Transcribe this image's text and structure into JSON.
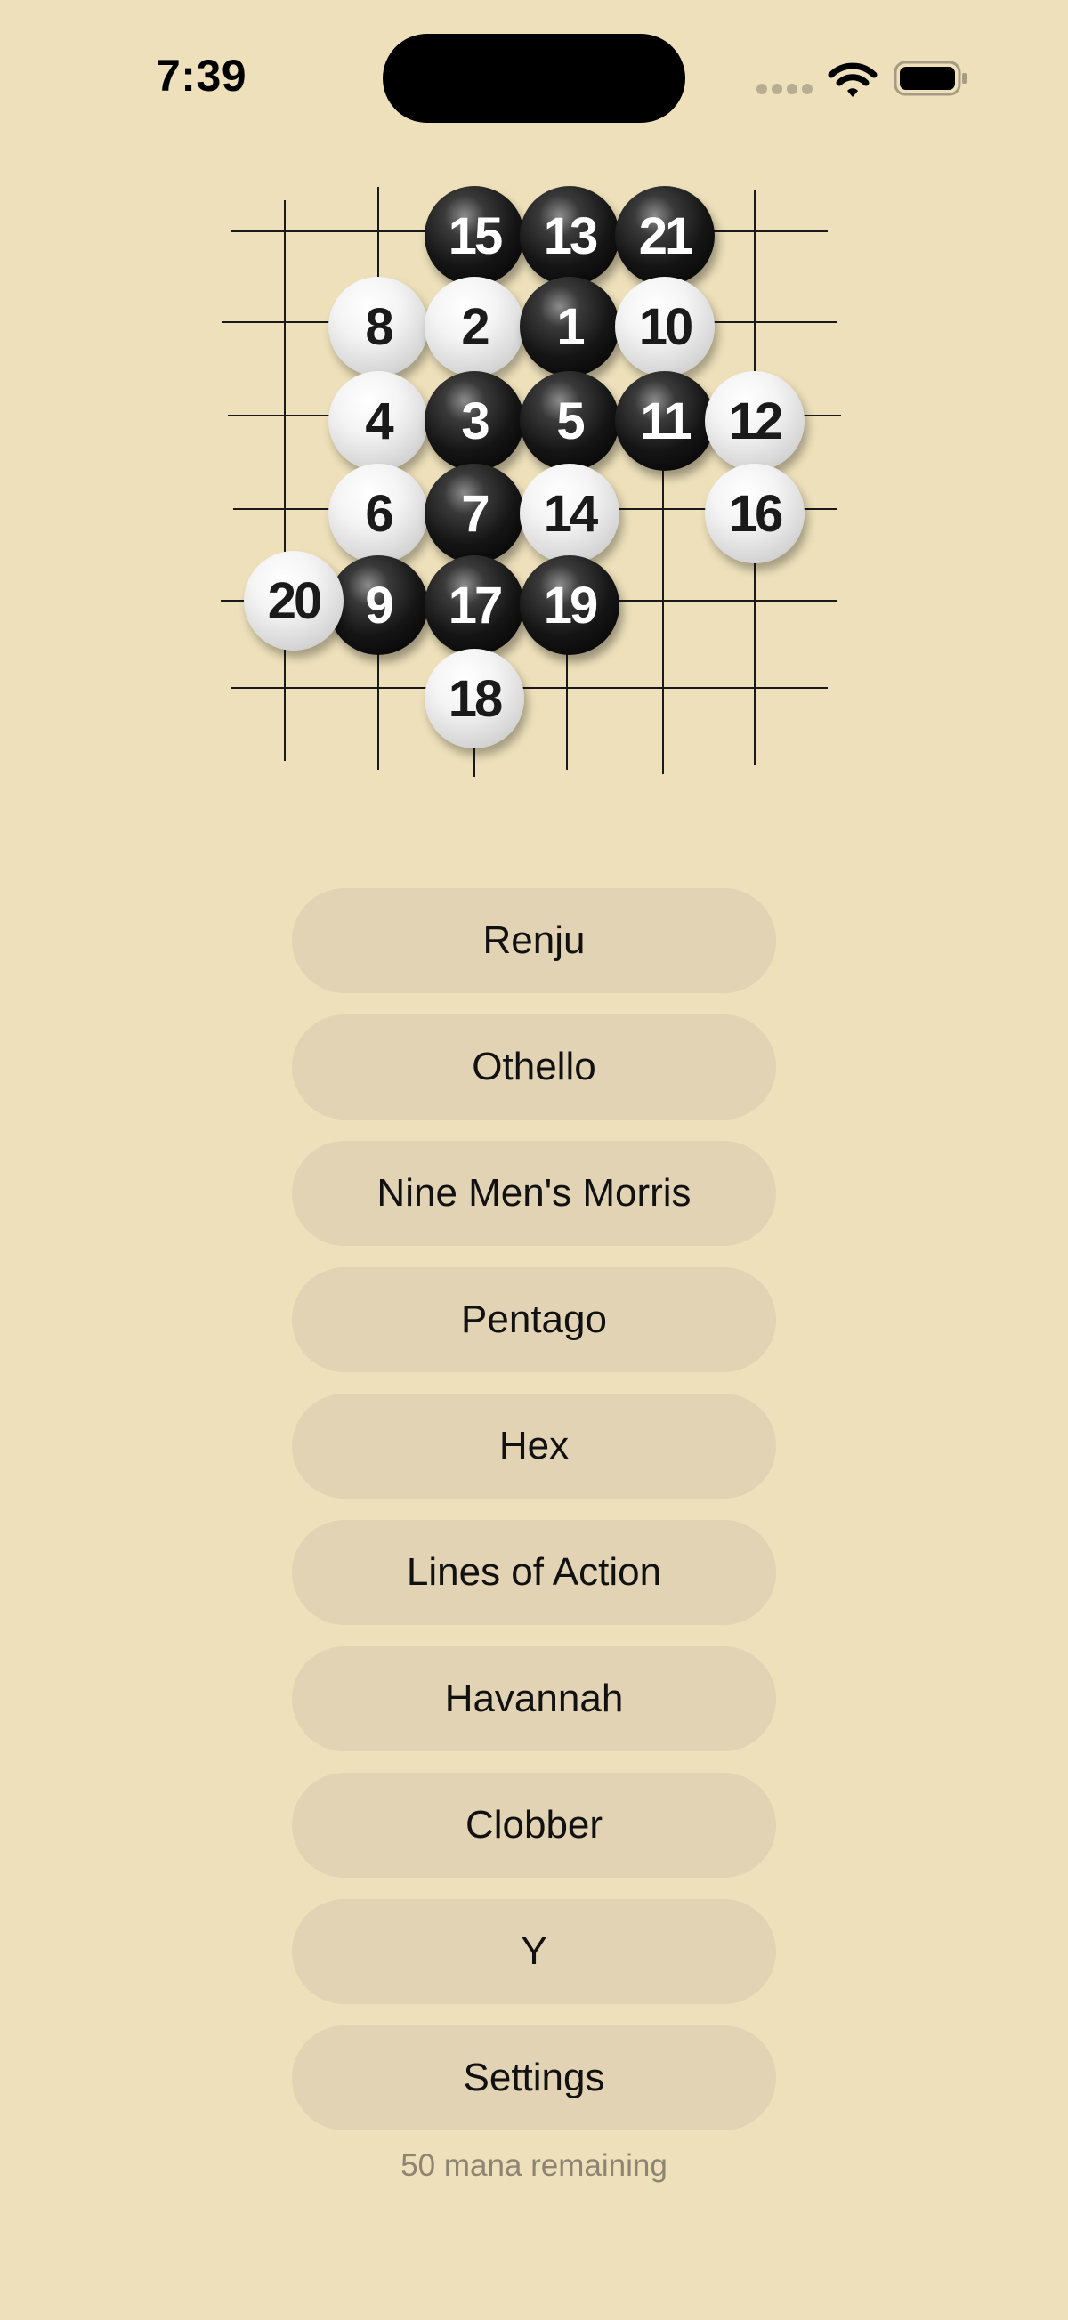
{
  "status_bar": {
    "time": "7:39"
  },
  "board": {
    "stones": [
      {
        "n": "15",
        "c": "black",
        "col": 2,
        "row": 0
      },
      {
        "n": "13",
        "c": "black",
        "col": 3,
        "row": 0
      },
      {
        "n": "21",
        "c": "black",
        "col": 4,
        "row": 0
      },
      {
        "n": "8",
        "c": "white",
        "col": 1,
        "row": 1
      },
      {
        "n": "2",
        "c": "white",
        "col": 2,
        "row": 1
      },
      {
        "n": "1",
        "c": "black",
        "col": 3,
        "row": 1
      },
      {
        "n": "10",
        "c": "white",
        "col": 4,
        "row": 1
      },
      {
        "n": "4",
        "c": "white",
        "col": 1,
        "row": 2
      },
      {
        "n": "3",
        "c": "black",
        "col": 2,
        "row": 2
      },
      {
        "n": "5",
        "c": "black",
        "col": 3,
        "row": 2
      },
      {
        "n": "11",
        "c": "black",
        "col": 4,
        "row": 2
      },
      {
        "n": "12",
        "c": "white",
        "col": 5,
        "row": 2
      },
      {
        "n": "6",
        "c": "white",
        "col": 1,
        "row": 3
      },
      {
        "n": "7",
        "c": "black",
        "col": 2,
        "row": 3
      },
      {
        "n": "14",
        "c": "white",
        "col": 3,
        "row": 3
      },
      {
        "n": "16",
        "c": "white",
        "col": 5,
        "row": 3
      },
      {
        "n": "9",
        "c": "black",
        "col": 1,
        "row": 4
      },
      {
        "n": "20",
        "c": "white",
        "col": 0,
        "row": 4
      },
      {
        "n": "17",
        "c": "black",
        "col": 2,
        "row": 4
      },
      {
        "n": "19",
        "c": "black",
        "col": 3,
        "row": 4
      },
      {
        "n": "18",
        "c": "white",
        "col": 2,
        "row": 5
      }
    ]
  },
  "menu": {
    "items": [
      {
        "label": "Renju",
        "name": "renju-button"
      },
      {
        "label": "Othello",
        "name": "othello-button"
      },
      {
        "label": "Nine Men's Morris",
        "name": "nine-mens-morris-button"
      },
      {
        "label": "Pentago",
        "name": "pentago-button"
      },
      {
        "label": "Hex",
        "name": "hex-button"
      },
      {
        "label": "Lines of Action",
        "name": "lines-of-action-button"
      },
      {
        "label": "Havannah",
        "name": "havannah-button"
      },
      {
        "label": "Clobber",
        "name": "clobber-button"
      },
      {
        "label": "Y",
        "name": "y-button"
      },
      {
        "label": "Settings",
        "name": "settings-button"
      }
    ]
  },
  "footer": {
    "mana": "50 mana remaining"
  },
  "colors": {
    "background": "#ede0ba",
    "button": "#e1d3b3",
    "mana_text": "#8e8472"
  }
}
